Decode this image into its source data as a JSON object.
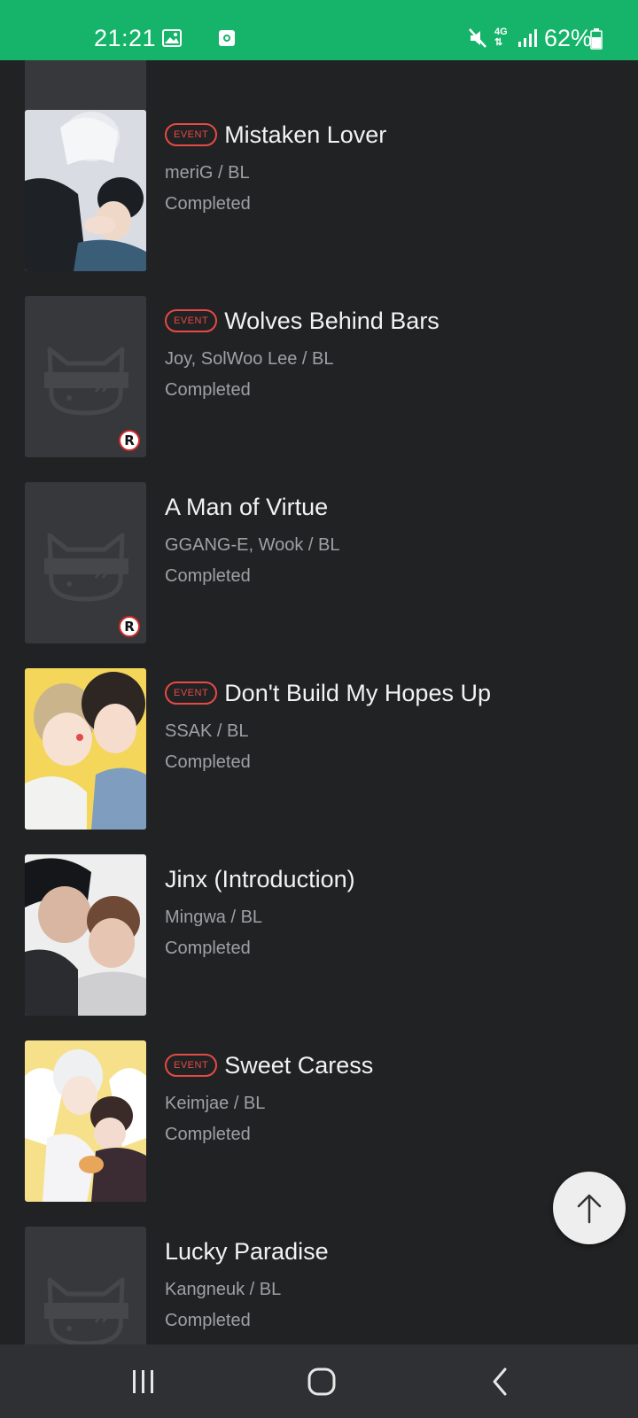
{
  "status_bar": {
    "time": "21:21",
    "network": "4G",
    "battery": "62%",
    "color": "#15b46a"
  },
  "badges": {
    "event": "EVENT",
    "rating": "R"
  },
  "items": [
    {
      "title": "",
      "author": "",
      "status": "",
      "event": false,
      "rated": true,
      "placeholder": true
    },
    {
      "title": "Mistaken Lover",
      "author": "meriG / BL",
      "status": "Completed",
      "event": true,
      "rated": false,
      "placeholder": false
    },
    {
      "title": "Wolves Behind Bars",
      "author": "Joy, SolWoo Lee / BL",
      "status": "Completed",
      "event": true,
      "rated": true,
      "placeholder": true
    },
    {
      "title": "A Man of Virtue",
      "author": "GGANG-E, Wook / BL",
      "status": "Completed",
      "event": false,
      "rated": true,
      "placeholder": true
    },
    {
      "title": "Don't Build My Hopes Up",
      "author": "SSAK / BL",
      "status": "Completed",
      "event": true,
      "rated": false,
      "placeholder": false
    },
    {
      "title": "Jinx (Introduction)",
      "author": "Mingwa / BL",
      "status": "Completed",
      "event": false,
      "rated": false,
      "placeholder": false
    },
    {
      "title": "Sweet Caress",
      "author": "Keimjae / BL",
      "status": "Completed",
      "event": true,
      "rated": false,
      "placeholder": false
    },
    {
      "title": "Lucky Paradise",
      "author": "Kangneuk / BL",
      "status": "Completed",
      "event": false,
      "rated": false,
      "placeholder": true
    }
  ],
  "scroll_top": {
    "icon": "arrow-up-icon"
  },
  "nav": {
    "recents": "recents-icon",
    "home": "home-icon",
    "back": "back-icon"
  },
  "colors": {
    "background": "#212224",
    "event_accent": "#e64a45",
    "secondary_text": "#9ea0a4"
  }
}
